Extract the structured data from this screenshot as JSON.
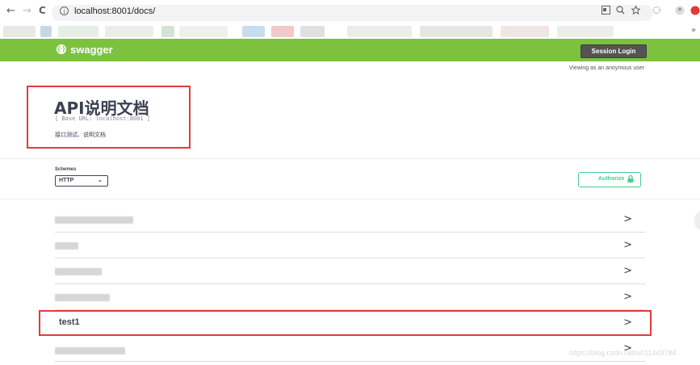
{
  "browser": {
    "url": "localhost:8001/docs/",
    "back_glyph": "←",
    "forward_glyph": "→",
    "reload_glyph": "C",
    "info_glyph": "i",
    "ext_more_glyph": "»"
  },
  "topbar": {
    "logo_glyph": "{·}",
    "logo_text": "swagger",
    "session_login": "Session Login"
  },
  "viewing": "Viewing as an anoymous user",
  "info": {
    "title": "API说明文档",
    "base_url": "[ Base URL: localhost:8001 ]",
    "description": "接口测试、说明文档"
  },
  "schemes": {
    "label": "Schemes",
    "selected": "HTTP",
    "chevron": "⌄"
  },
  "authorize": {
    "label": "Authorize"
  },
  "tags": {
    "arrow": ">",
    "visible_name": "test1"
  },
  "watermark": "https://blog.csdn.net/u011449784",
  "colors": {
    "swagger_green": "#7cc23f",
    "authorize_green": "#49cc90",
    "highlight_red": "#e03c3c"
  }
}
